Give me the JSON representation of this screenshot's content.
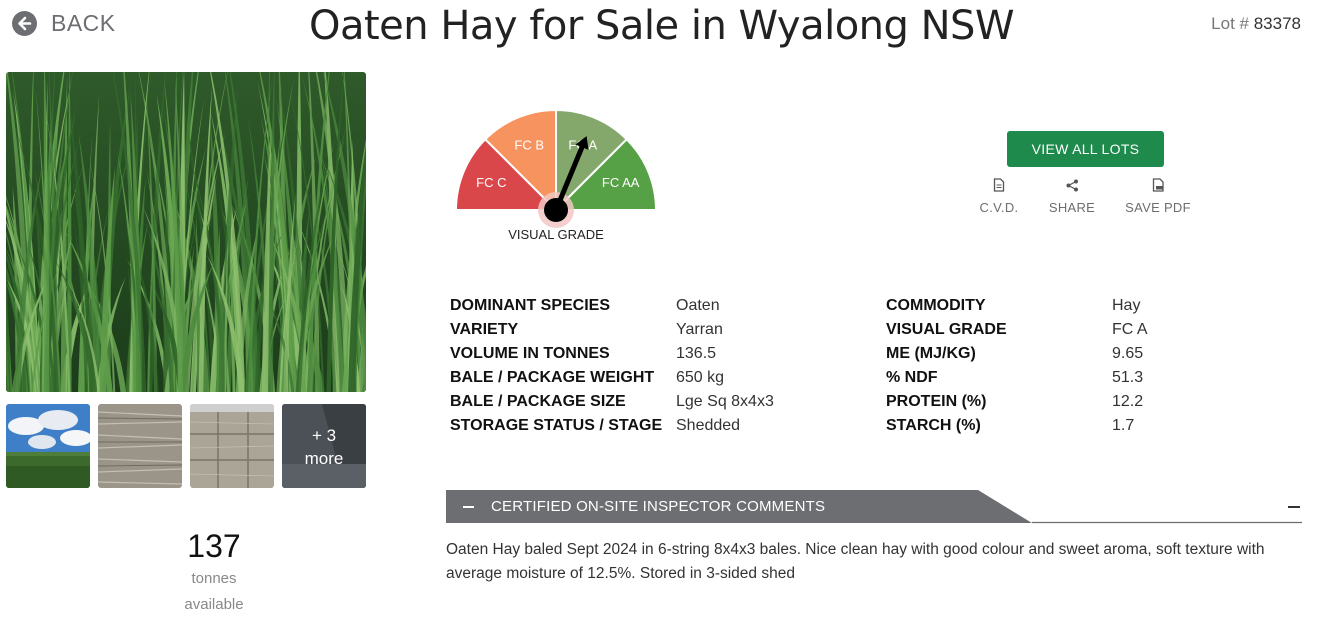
{
  "header": {
    "back_label": "BACK",
    "title": "Oaten Hay for Sale in Wyalong NSW",
    "lot_prefix": "Lot #",
    "lot_number": "83378"
  },
  "gallery": {
    "more_count": "+ 3",
    "more_label": "more"
  },
  "availability": {
    "amount": "137",
    "unit": "tonnes",
    "status": "available"
  },
  "gauge": {
    "segments": [
      {
        "label": "FC C",
        "color": "#d9474a"
      },
      {
        "label": "FC B",
        "color": "#f7935f"
      },
      {
        "label": "FC A",
        "color": "#84a86c"
      },
      {
        "label": "FC AA",
        "color": "#56a146"
      }
    ],
    "selected": "FC A",
    "caption": "VISUAL GRADE"
  },
  "actions": {
    "view_all": "VIEW ALL LOTS",
    "cvd": "C.V.D.",
    "share": "SHARE",
    "save_pdf": "SAVE PDF"
  },
  "specs_left": [
    {
      "label": "DOMINANT SPECIES",
      "value": "Oaten"
    },
    {
      "label": "VARIETY",
      "value": "Yarran"
    },
    {
      "label": "VOLUME IN TONNES",
      "value": "136.5"
    },
    {
      "label": "BALE / PACKAGE WEIGHT",
      "value": "650 kg"
    },
    {
      "label": "BALE / PACKAGE SIZE",
      "value": "Lge Sq 8x4x3"
    },
    {
      "label": "STORAGE STATUS / STAGE",
      "value": "Shedded"
    }
  ],
  "specs_right": [
    {
      "label": "COMMODITY",
      "value": "Hay"
    },
    {
      "label": "VISUAL GRADE",
      "value": "FC A"
    },
    {
      "label": "ME (MJ/KG)",
      "value": "9.65"
    },
    {
      "label": "% NDF",
      "value": "51.3"
    },
    {
      "label": "PROTEIN (%)",
      "value": "12.2"
    },
    {
      "label": "STARCH (%)",
      "value": "1.7"
    }
  ],
  "comments": {
    "title": "CERTIFIED ON-SITE INSPECTOR COMMENTS",
    "text": "Oaten Hay baled Sept 2024 in 6-string 8x4x3 bales. Nice clean hay with good colour and sweet aroma, soft texture with average moisture of 12.5%. Stored in 3-sided shed"
  },
  "colors": {
    "accent_green": "#1e8a4c",
    "comments_bar": "#6c6e71"
  }
}
